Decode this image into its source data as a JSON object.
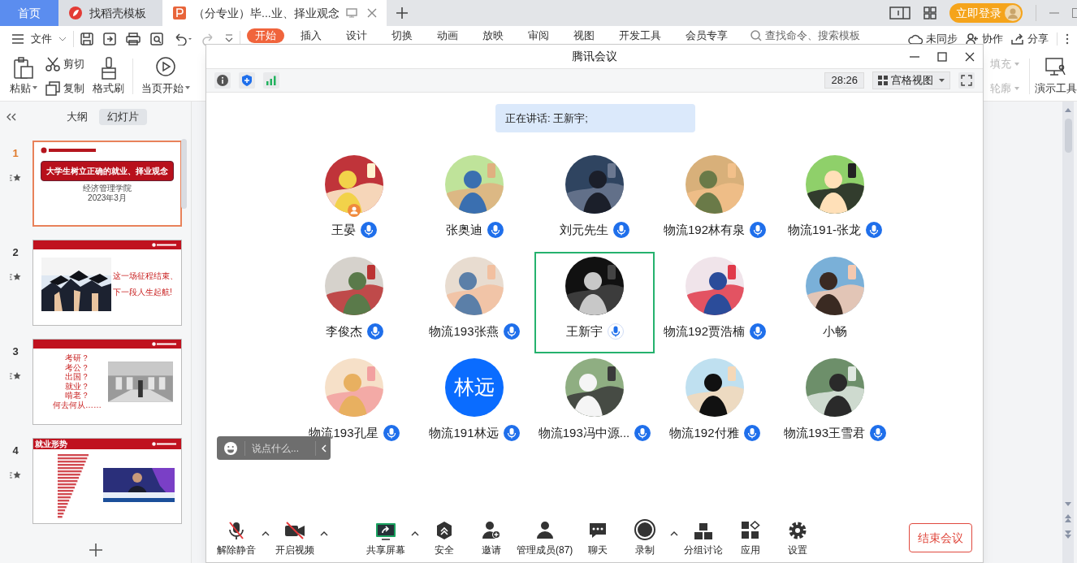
{
  "tabs": [
    {
      "label": "首页",
      "kind": "home",
      "selected": false
    },
    {
      "label": "找稻壳模板",
      "kind": "template",
      "selected": false
    },
    {
      "label": "（分专业）毕...业、择业观念",
      "kind": "document",
      "selected": true
    }
  ],
  "login_button": "立即登录",
  "menu": {
    "file": "文件",
    "tabs": [
      {
        "label": "开始",
        "selected": true
      },
      {
        "label": "插入",
        "selected": false
      },
      {
        "label": "设计",
        "selected": false
      },
      {
        "label": "切换",
        "selected": false
      },
      {
        "label": "动画",
        "selected": false
      },
      {
        "label": "放映",
        "selected": false
      },
      {
        "label": "审阅",
        "selected": false
      },
      {
        "label": "视图",
        "selected": false
      },
      {
        "label": "开发工具",
        "selected": false
      },
      {
        "label": "会员专享",
        "selected": false
      }
    ],
    "search": {
      "placeholder": "查找命令、搜索模板"
    },
    "sync": "未同步",
    "collaborate": "协作",
    "share": "分享"
  },
  "ribbon": {
    "paste": "粘贴",
    "cut": "剪切",
    "copy": "复制",
    "format_painter": "格式刷",
    "play_from_current": "当页开始",
    "fill": "填充",
    "outline": "轮廓",
    "presenter_tools": "演示工具"
  },
  "slide_panel": {
    "tabs": [
      {
        "label": "大纲",
        "selected": false
      },
      {
        "label": "幻灯片",
        "selected": true
      }
    ],
    "slides": [
      {
        "number": "1",
        "selected": true,
        "kind": "title",
        "title": "大学生树立正确的就业、择业观念",
        "subtitle": "经济管理学院",
        "date": "2023年3月"
      },
      {
        "number": "2",
        "selected": false,
        "kind": "photo_text",
        "lines": [
          "这一场征程结束、",
          "下一段人生起航!"
        ]
      },
      {
        "number": "3",
        "selected": false,
        "kind": "list_photo",
        "lines": [
          "考研？",
          "考公？",
          "出国？",
          "就业？",
          "啃老？",
          "何去何从……"
        ]
      },
      {
        "number": "4",
        "selected": false,
        "kind": "chart_video",
        "heading": "就业形势"
      }
    ]
  },
  "meeting": {
    "title": "腾讯会议",
    "timer": "28:26",
    "view_mode": "宫格视图",
    "speaking_banner": "正在讲话: 王新宇;",
    "participants": [
      {
        "name": "王晏",
        "mic": true,
        "speaking": false,
        "host": true,
        "selected": false
      },
      {
        "name": "张奥迪",
        "mic": true,
        "speaking": false,
        "host": false,
        "selected": false
      },
      {
        "name": "刘元先生",
        "mic": true,
        "speaking": false,
        "host": false,
        "selected": false
      },
      {
        "name": "物流192林有泉",
        "mic": true,
        "speaking": false,
        "host": false,
        "selected": false
      },
      {
        "name": "物流191-张龙",
        "mic": true,
        "speaking": false,
        "host": false,
        "selected": false
      },
      {
        "name": "李俊杰",
        "mic": true,
        "speaking": false,
        "host": false,
        "selected": false
      },
      {
        "name": "物流193张燕",
        "mic": true,
        "speaking": false,
        "host": false,
        "selected": false
      },
      {
        "name": "王新宇",
        "mic": true,
        "speaking": true,
        "host": false,
        "selected": true
      },
      {
        "name": "物流192贾浩楠",
        "mic": true,
        "speaking": false,
        "host": false,
        "selected": false
      },
      {
        "name": "小畅",
        "mic": false,
        "speaking": false,
        "host": false,
        "selected": false
      },
      {
        "name": "物流193孔星",
        "mic": true,
        "speaking": false,
        "host": false,
        "selected": false
      },
      {
        "name": "物流191林远",
        "avatar_text": "林远",
        "mic": true,
        "speaking": false,
        "host": false,
        "selected": false
      },
      {
        "name": "物流193冯中源...",
        "mic": true,
        "speaking": false,
        "host": false,
        "selected": false
      },
      {
        "name": "物流192付雅",
        "mic": true,
        "speaking": false,
        "host": false,
        "selected": false
      },
      {
        "name": "物流193王雪君",
        "mic": true,
        "speaking": false,
        "host": false,
        "selected": false
      }
    ],
    "chat": {
      "placeholder": "说点什么..."
    },
    "toolbar": [
      {
        "label": "解除静音",
        "kind": "mic_muted",
        "menu": true
      },
      {
        "label": "开启视频",
        "kind": "camera_off",
        "menu": true
      },
      {
        "label": "共享屏幕",
        "kind": "share",
        "menu": true
      },
      {
        "label": "安全",
        "kind": "security",
        "menu": false
      },
      {
        "label": "邀请",
        "kind": "invite",
        "menu": false
      },
      {
        "label": "管理成员(87)",
        "kind": "members",
        "menu": false
      },
      {
        "label": "聊天",
        "kind": "chat",
        "menu": false
      },
      {
        "label": "录制",
        "kind": "record",
        "menu": true
      },
      {
        "label": "分组讨论",
        "kind": "breakout",
        "menu": false
      },
      {
        "label": "应用",
        "kind": "apps",
        "menu": false
      },
      {
        "label": "设置",
        "kind": "settings",
        "menu": false
      }
    ],
    "end_button": "结束会议"
  }
}
